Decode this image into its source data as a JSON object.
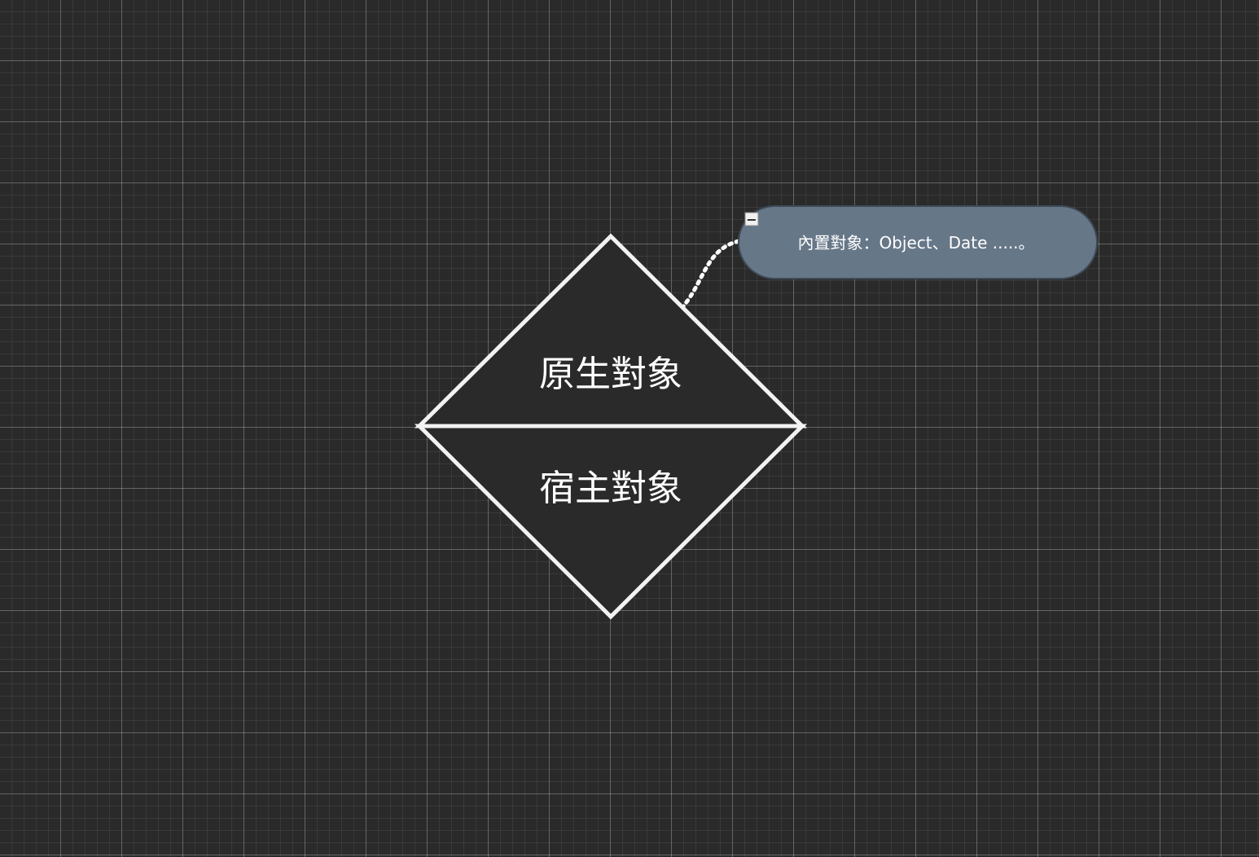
{
  "diagram": {
    "top_label": "原生對象",
    "bottom_label": "宿主對象",
    "callout": {
      "text": "內置對象：Object、Date .....。",
      "fill_color": "#667788",
      "collapse_symbol": "−"
    },
    "colors": {
      "background": "#2a2a2a",
      "shape_fill": "#2a2a2a",
      "shape_stroke": "#f2f2f2"
    }
  }
}
